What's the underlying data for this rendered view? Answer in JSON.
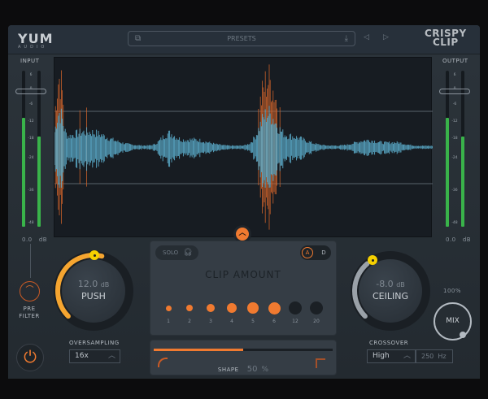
{
  "header": {
    "logo": "YUM",
    "logo_sub": "AUDIO",
    "presets": "PRESETS",
    "brand_line1": "CRISPY",
    "brand_line2": "CLIP"
  },
  "input": {
    "label": "INPUT",
    "value": "0.0",
    "unit": "dB",
    "level_left": 0.7,
    "level_right": 0.58
  },
  "output": {
    "label": "OUTPUT",
    "value": "0.0",
    "unit": "dB",
    "level_left": 0.7,
    "level_right": 0.58
  },
  "meter_ticks": [
    "6",
    "0",
    "-6",
    "-12",
    "-18",
    "-24",
    "-36",
    "-48"
  ],
  "push": {
    "value": "12.0",
    "unit": "dB",
    "label": "PUSH",
    "fraction": 0.55
  },
  "ceiling": {
    "value": "-8.0",
    "unit": "dB",
    "label": "CEILING",
    "fraction": 0.35
  },
  "pre_filter": {
    "line1": "PRE",
    "line2": "FILTER"
  },
  "oversampling": {
    "label": "OVERSAMPLING",
    "value": "16x"
  },
  "clip": {
    "solo": "SOLO",
    "mode_a": "A",
    "mode_d": "D",
    "title": "CLIP AMOUNT",
    "steps": [
      "1",
      "2",
      "3",
      "4",
      "5",
      "6",
      "12",
      "20"
    ],
    "active_steps": 6
  },
  "shape": {
    "label": "SHAPE",
    "value": "50",
    "unit": "%",
    "fraction": 0.5
  },
  "crossover": {
    "label": "CROSSOVER",
    "value": "High",
    "freq": "250",
    "freq_unit": "Hz"
  },
  "mix": {
    "label": "MIX",
    "value": "100%",
    "fraction": 1.0
  },
  "colors": {
    "accent": "#f07a30",
    "knob_handle": "#f5d000",
    "meter": "#39b34a",
    "wave": "#5fb6d6"
  }
}
